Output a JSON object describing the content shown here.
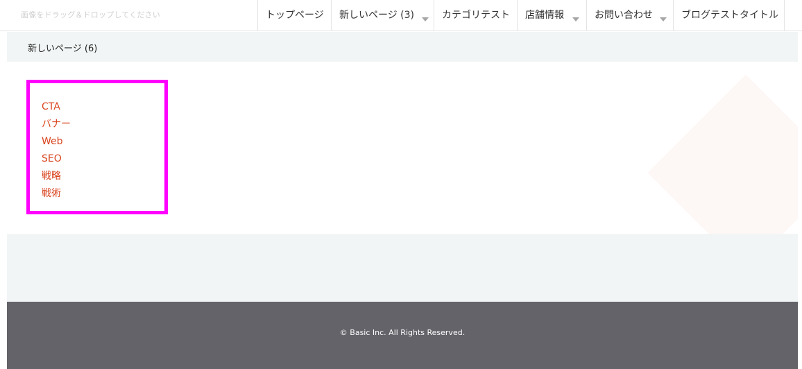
{
  "header": {
    "logo_text": "画像をドラッグ＆ドロップしてください",
    "nav": [
      {
        "label": "トップページ",
        "has_dropdown": false
      },
      {
        "label": "新しいページ (3)",
        "has_dropdown": true
      },
      {
        "label": "カテゴリテスト",
        "has_dropdown": false
      },
      {
        "label": "店舗情報",
        "has_dropdown": true
      },
      {
        "label": "お問い合わせ",
        "has_dropdown": true
      },
      {
        "label": "ブログテストタイトル",
        "has_dropdown": false
      }
    ]
  },
  "breadcrumb": {
    "label": "新しいページ (6)"
  },
  "tags": [
    {
      "label": "CTA"
    },
    {
      "label": "バナー"
    },
    {
      "label": "Web"
    },
    {
      "label": "SEO"
    },
    {
      "label": "戦略"
    },
    {
      "label": "戦術"
    }
  ],
  "footer": {
    "copyright": "© Basic Inc. All Rights Reserved."
  },
  "colors": {
    "accent_link": "#d9441e",
    "highlight_border": "#ff00ff",
    "footer_bg": "#646369",
    "section_bg": "#f2f5f5"
  }
}
